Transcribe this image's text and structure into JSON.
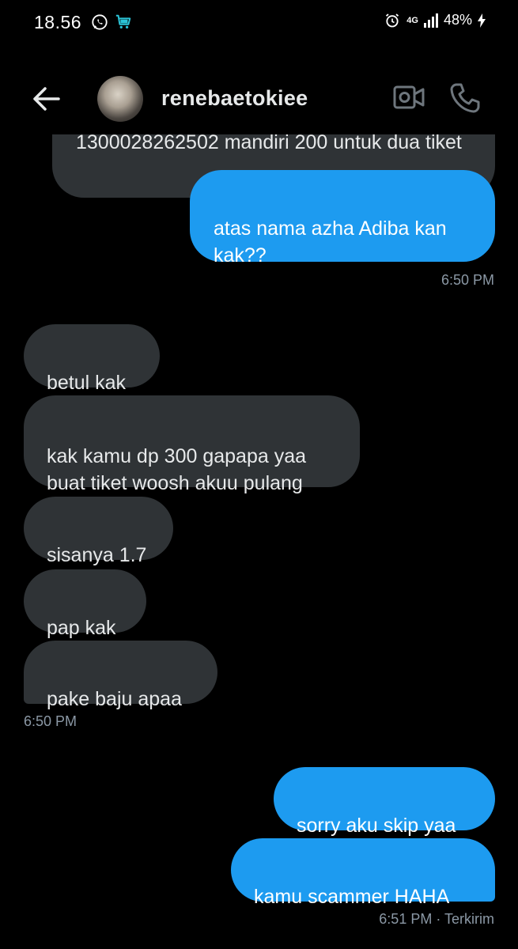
{
  "status_bar": {
    "time": "18.56",
    "network": "4G",
    "battery": "48%"
  },
  "header": {
    "contact_name": "renebaetokiee"
  },
  "messages": {
    "partial_text": "1300028262502 mandiri 200 untuk dua tiket",
    "m1": "atas nama azha Adiba kan\nkak??",
    "ts1": "6:50 PM",
    "m2": "betul kak",
    "m3": "kak kamu dp 300 gapapa yaa\nbuat tiket woosh akuu pulang",
    "m4": "sisanya 1.7",
    "m5": "pap kak",
    "m6": "pake baju apaa",
    "ts2": "6:50 PM",
    "m7": "sorry aku skip yaa",
    "m8": "kamu scammer HAHA",
    "ts3": "6:51 PM · Terkirim"
  },
  "colors": {
    "background": "#000000",
    "incoming_bubble": "#2f3336",
    "outgoing_bubble": "#1d9bf0",
    "timestamp": "#8b98a5"
  }
}
